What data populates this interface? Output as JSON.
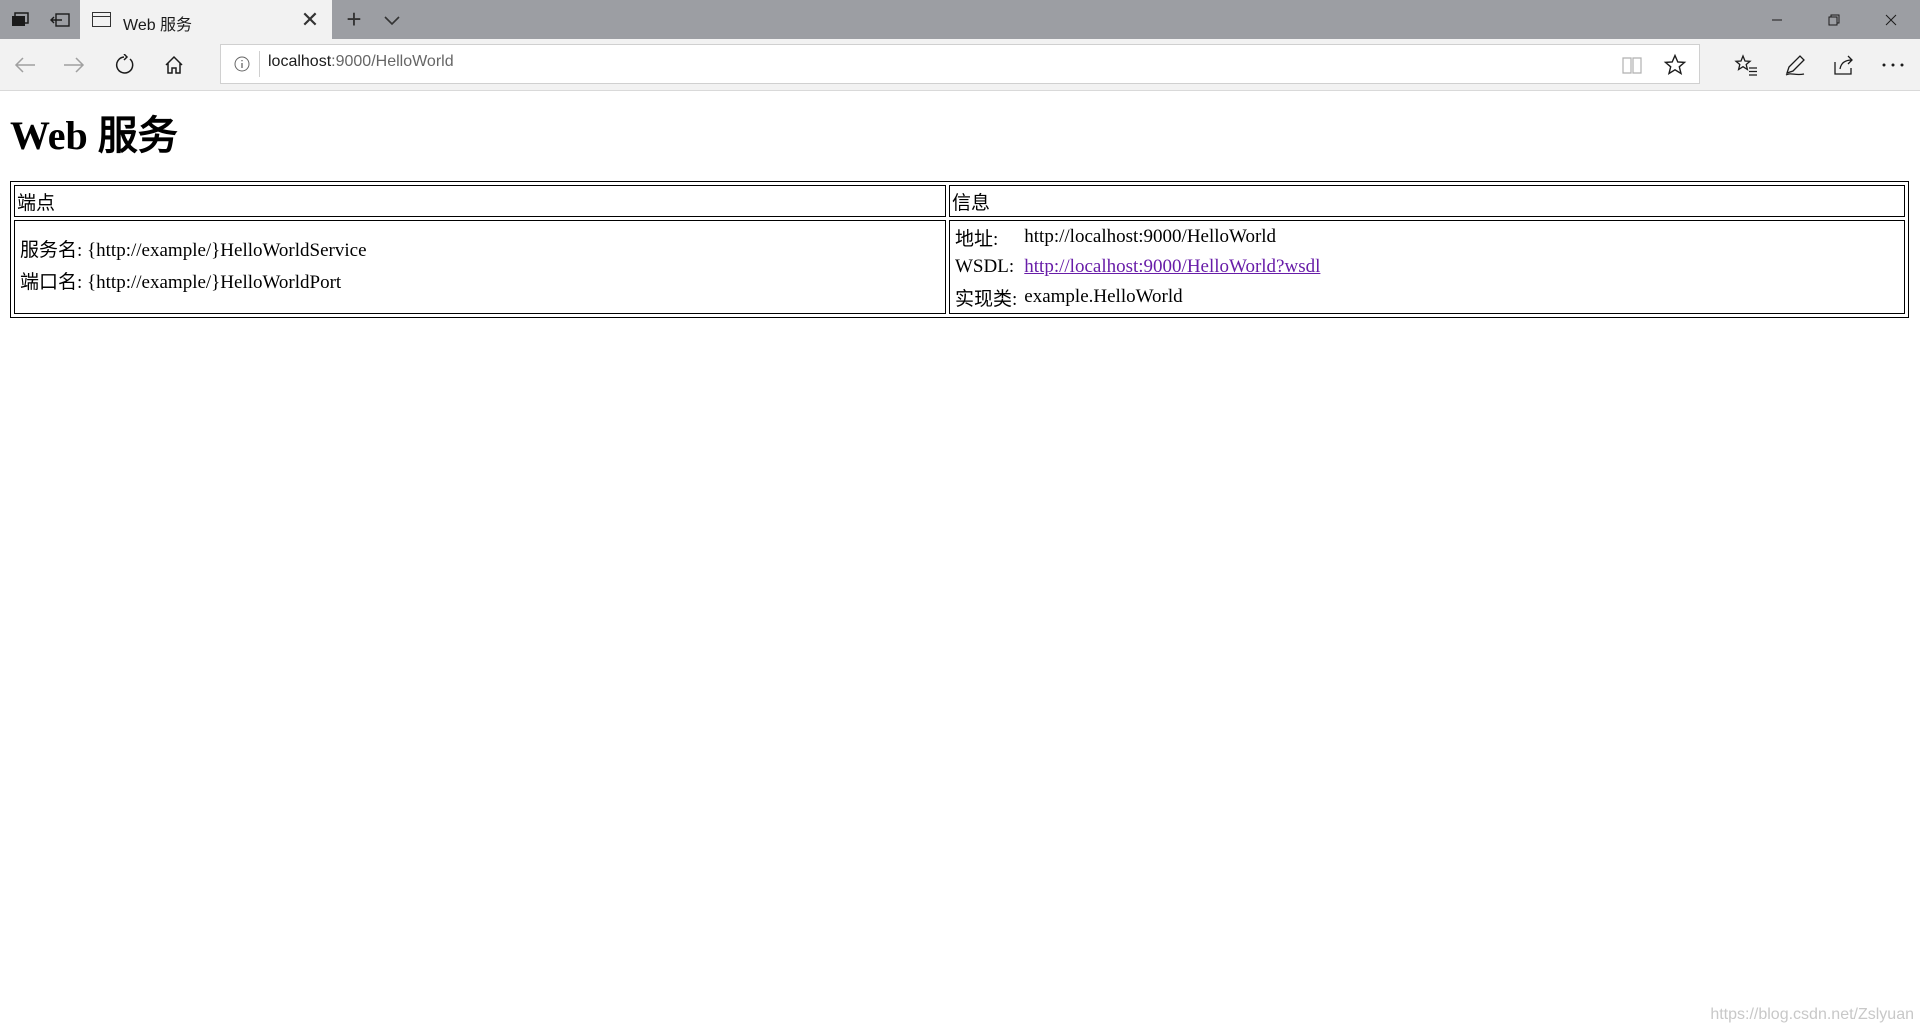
{
  "browser": {
    "tab": {
      "title": "Web 服务"
    },
    "address": {
      "host": "localhost",
      "path": ":9000/HelloWorld"
    }
  },
  "page": {
    "title": "Web 服务",
    "table": {
      "headers": {
        "endpoint": "端点",
        "info": "信息"
      },
      "endpoint": {
        "service_label": "服务名:",
        "service_value": "{http://example/}HelloWorldService",
        "port_label": "端口名:",
        "port_value": "{http://example/}HelloWorldPort"
      },
      "info": {
        "address_label": "地址:",
        "address_value": "http://localhost:9000/HelloWorld",
        "wsdl_label": "WSDL:",
        "wsdl_link": "http://localhost:9000/HelloWorld?wsdl",
        "impl_label": "实现类:",
        "impl_value": "example.HelloWorld"
      }
    }
  },
  "watermark": "https://blog.csdn.net/Zslyuan",
  "colors": {
    "titlebar": "#9c9ea3",
    "toolbar": "#f2f2f2",
    "visited_link": "#681da8"
  }
}
